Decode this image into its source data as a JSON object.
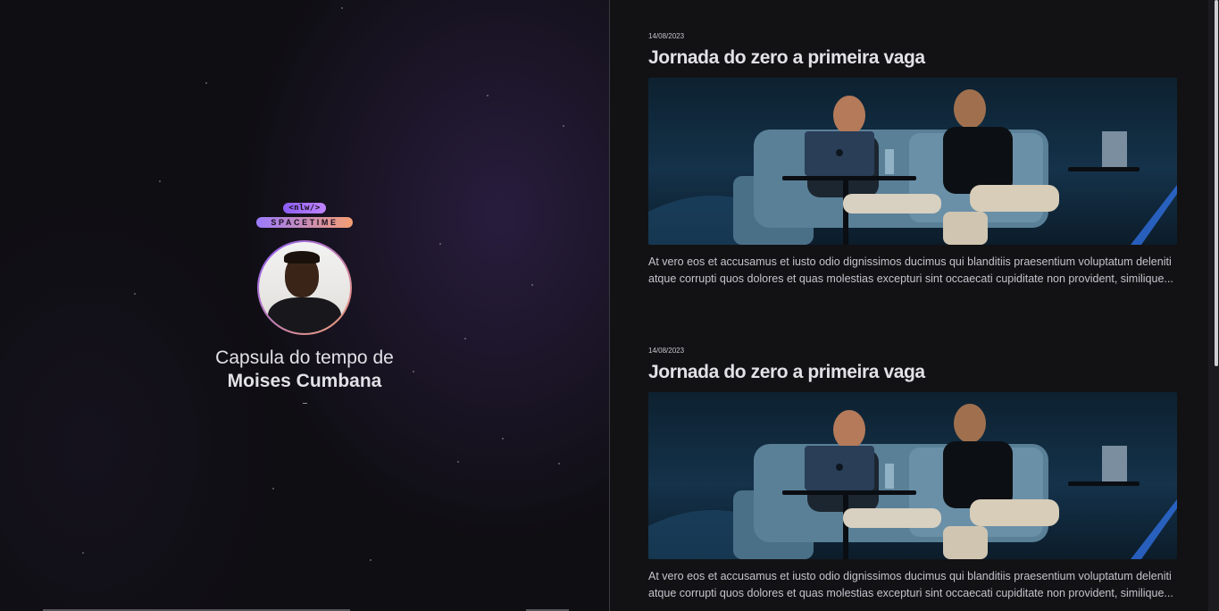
{
  "brand": {
    "code_badge": "<nlw/>",
    "wordmark": "SPACETIME",
    "accent_from": "#8b5cf6",
    "accent_to": "#f59e72"
  },
  "profile": {
    "avatar_icon": "user-photo",
    "line1": "Capsula do tempo de",
    "name": "Moises Cumbana"
  },
  "memories": [
    {
      "date": "14/08/2023",
      "title": "Jornada do zero a primeira vaga",
      "image_icon": "stage-photo",
      "excerpt": "At vero eos et accusamus et iusto odio dignissimos ducimus qui blanditiis praesentium voluptatum deleniti atque corrupti quos dolores et quas molestias excepturi sint occaecati cupiditate non provident, similique..."
    },
    {
      "date": "14/08/2023",
      "title": "Jornada do zero a primeira vaga",
      "image_icon": "stage-photo",
      "excerpt": "At vero eos et accusamus et iusto odio dignissimos ducimus qui blanditiis praesentium voluptatum deleniti atque corrupti quos dolores et quas molestias excepturi sint occaecati cupiditate non provident, similique..."
    }
  ]
}
